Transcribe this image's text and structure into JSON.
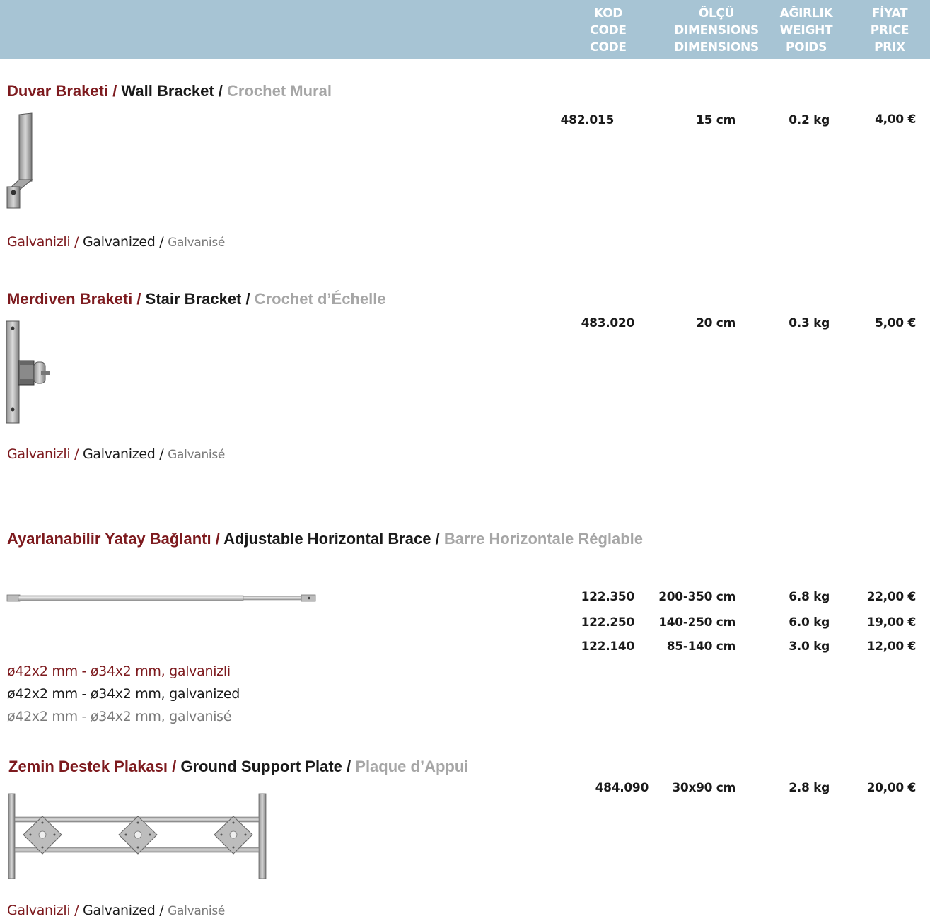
{
  "header": {
    "code": [
      "KOD",
      "CODE",
      "CODE"
    ],
    "dimensions": [
      "ÖLÇÜ",
      "DIMENSIONS",
      "DIMENSIONS"
    ],
    "weight": [
      "AĞIRLIK",
      "WEIGHT",
      "POIDS"
    ],
    "price": [
      "FİYAT",
      "PRICE",
      "PRIX"
    ]
  },
  "products": [
    {
      "title_tr": "Duvar Braketi",
      "title_en": "Wall Bracket",
      "title_fr": "Crochet Mural",
      "note_tr": "Galvanizli",
      "note_en": "Galvanized",
      "note_fr": "Galvanisé",
      "rows": [
        {
          "code": "482.015",
          "dim": "15 cm",
          "weight": "0.2 kg",
          "price": "4,00 €"
        }
      ],
      "image_icon": "wall-bracket-photo"
    },
    {
      "title_tr": "Merdiven Braketi",
      "title_en": "Stair Bracket",
      "title_fr": "Crochet d’Échelle",
      "note_tr": "Galvanizli",
      "note_en": "Galvanized",
      "note_fr": "Galvanisé",
      "rows": [
        {
          "code": "483.020",
          "dim": "20 cm",
          "weight": "0.3 kg",
          "price": "5,00 €"
        }
      ],
      "image_icon": "stair-bracket-photo"
    },
    {
      "title_tr": "Ayarlanabilir Yatay Bağlantı",
      "title_en": "Adjustable Horizontal Brace",
      "title_fr": "Barre Horizontale Réglable",
      "spec_tr": "ø42x2 mm - ø34x2 mm, galvanizli",
      "spec_en": "ø42x2 mm - ø34x2 mm, galvanized",
      "spec_fr": "ø42x2 mm - ø34x2 mm, galvanisé",
      "rows": [
        {
          "code": "122.350",
          "dim": "200-350 cm",
          "weight": "6.8 kg",
          "price": "22,00 €"
        },
        {
          "code": "122.250",
          "dim": "140-250 cm",
          "weight": "6.0 kg",
          "price": "19,00 €"
        },
        {
          "code": "122.140",
          "dim": "85-140 cm",
          "weight": "3.0 kg",
          "price": "12,00 €"
        }
      ],
      "image_icon": "horizontal-brace-photo"
    },
    {
      "title_tr": "Zemin Destek Plakası",
      "title_en": "Ground Support Plate",
      "title_fr": "Plaque d’Appui",
      "note_tr": "Galvanizli",
      "note_en": "Galvanized",
      "note_fr": "Galvanisé",
      "rows": [
        {
          "code": "484.090",
          "dim": "30x90 cm",
          "weight": "2.8 kg",
          "price": "20,00 €"
        }
      ],
      "image_icon": "ground-support-plate-photo"
    }
  ],
  "separator": "/"
}
